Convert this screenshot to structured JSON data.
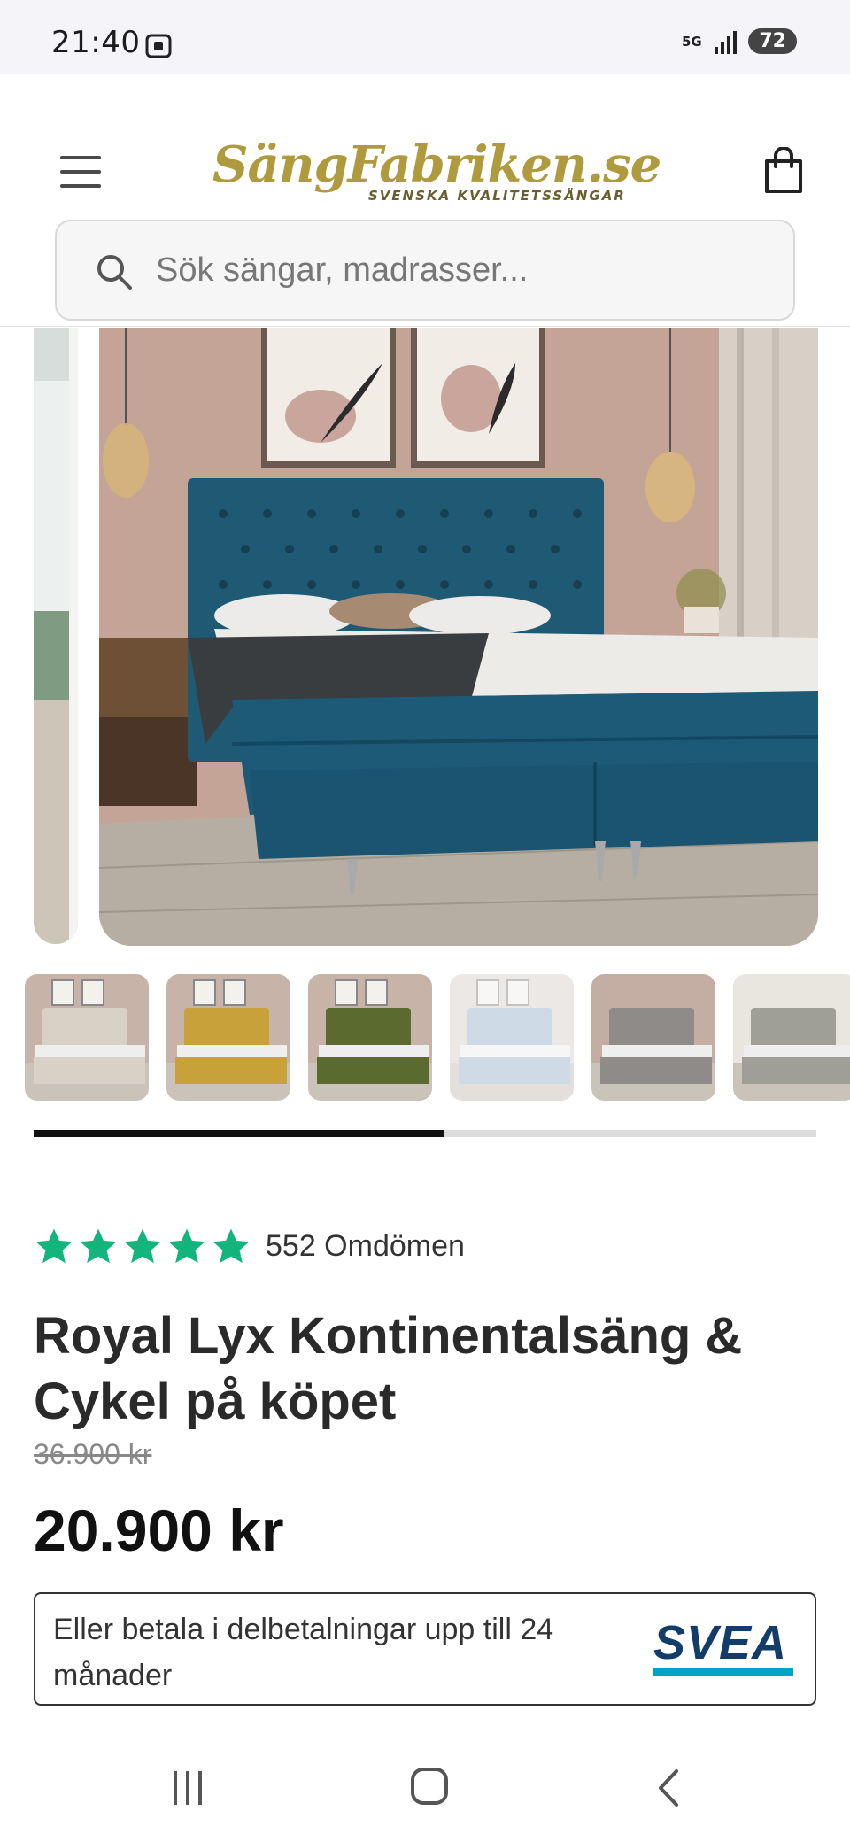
{
  "status_bar": {
    "time": "21:40",
    "network": "5G",
    "battery": "72"
  },
  "header": {
    "logo_text": "SängFabriken.se",
    "logo_tagline": "SVENSKA KVALITETSSÄNGAR",
    "search_placeholder": "Sök sängar, madrasser..."
  },
  "gallery": {
    "main_image_alt": "Royal Lyx Kontinentalsäng i blå sammet",
    "thumbnails": [
      {
        "color": "#d8d1c5",
        "wall": "#c7b3a8"
      },
      {
        "color": "#c9a13a",
        "wall": "#c7b3a8"
      },
      {
        "color": "#5b6b2f",
        "wall": "#c7b3a8"
      },
      {
        "color": "#9fb8cf",
        "wall": "#d9d2cc"
      },
      {
        "color": "#8e8b88",
        "wall": "#c4aea3"
      },
      {
        "color": "#9f9f97",
        "wall": "#e8e6df"
      }
    ],
    "progress_fraction": 0.525
  },
  "product": {
    "rating_stars": 5,
    "rating_color": "#14b57c",
    "reviews_label": "552 Omdömen",
    "title": "Royal Lyx Kontinentalsäng & Cykel på köpet",
    "old_price": "36.900 kr",
    "price": "20.900 kr"
  },
  "financing": {
    "text": "Eller betala i delbetalningar upp till 24 månader",
    "logo_text": "SVEA"
  },
  "nav": {
    "recents_icon": "recents-icon",
    "home_icon": "home-icon",
    "back_icon": "back-icon"
  }
}
